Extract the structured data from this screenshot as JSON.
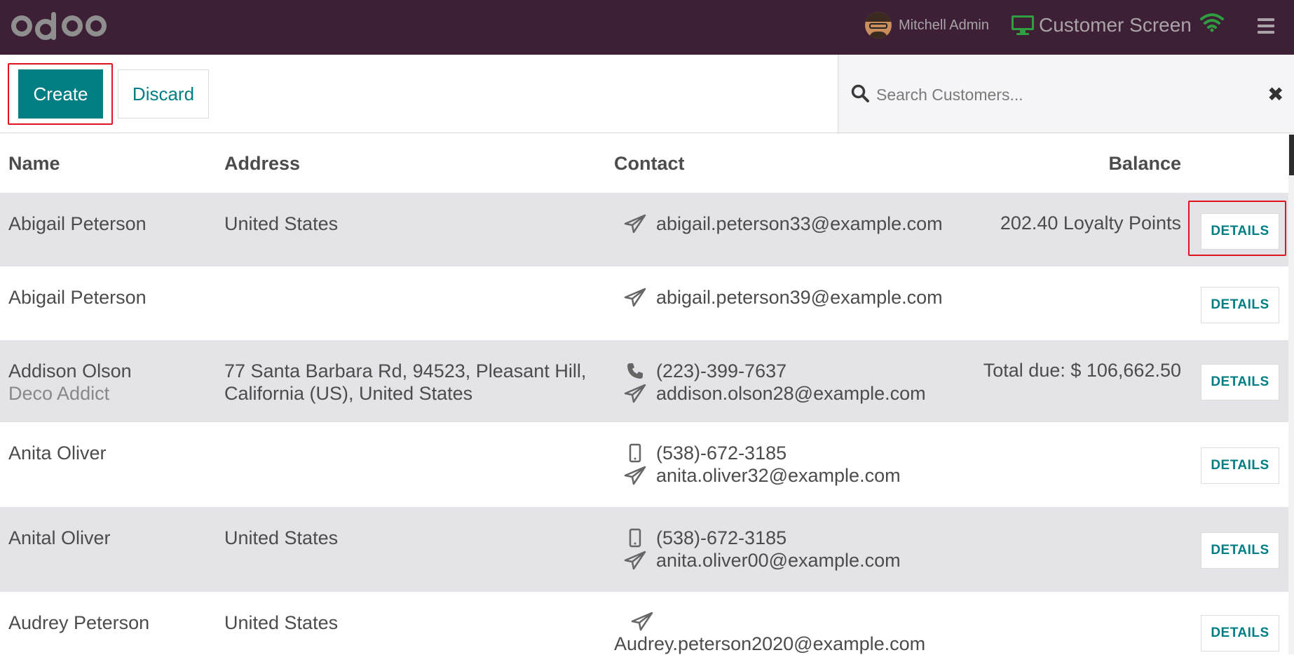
{
  "topbar": {
    "logo_text": "odoo",
    "user_name": "Mitchell Admin",
    "screen_label": "Customer Screen"
  },
  "controls": {
    "create_label": "Create",
    "discard_label": "Discard",
    "search_placeholder": "Search Customers..."
  },
  "columns": {
    "name": "Name",
    "address": "Address",
    "contact": "Contact",
    "balance": "Balance"
  },
  "rows": [
    {
      "name": "Abigail Peterson",
      "company": "",
      "address1": "United States",
      "address2": "",
      "phone": "",
      "phone_type": "",
      "email": "abigail.peterson33@example.com",
      "balance": "202.40 Loyalty Points",
      "details": "DETAILS"
    },
    {
      "name": "Abigail Peterson",
      "company": "",
      "address1": "",
      "address2": "",
      "phone": "",
      "phone_type": "",
      "email": "abigail.peterson39@example.com",
      "balance": "",
      "details": "DETAILS"
    },
    {
      "name": "Addison Olson",
      "company": "Deco Addict",
      "address1": "77 Santa Barbara Rd, 94523, Pleasant Hill,",
      "address2": "California (US), United States",
      "phone": "(223)-399-7637",
      "phone_type": "phone",
      "email": "addison.olson28@example.com",
      "balance": "Total due: $ 106,662.50",
      "details": "DETAILS"
    },
    {
      "name": "Anita Oliver",
      "company": "",
      "address1": "",
      "address2": "",
      "phone": "(538)-672-3185",
      "phone_type": "mobile",
      "email": "anita.oliver32@example.com",
      "balance": "",
      "details": "DETAILS"
    },
    {
      "name": "Anital Oliver",
      "company": "",
      "address1": "United States",
      "address2": "",
      "phone": "(538)-672-3185",
      "phone_type": "mobile",
      "email": "anita.oliver00@example.com",
      "balance": "",
      "details": "DETAILS"
    },
    {
      "name": "Audrey Peterson",
      "company": "",
      "address1": "United States",
      "address2": "",
      "phone": "",
      "phone_type": "",
      "email": "Audrey.peterson2020@example.com",
      "balance": "",
      "details": "DETAILS"
    }
  ],
  "colors": {
    "topbar": "#3e2036",
    "accent": "#017e84",
    "highlight": "#e0141e",
    "row_alt": "#e3e3e8"
  },
  "icons": {
    "email": "paper-plane-icon",
    "phone": "phone-icon",
    "mobile": "mobile-icon",
    "search": "search-icon",
    "clear": "close-icon",
    "menu": "hamburger-icon",
    "wifi": "wifi-icon",
    "screen": "monitor-icon"
  }
}
